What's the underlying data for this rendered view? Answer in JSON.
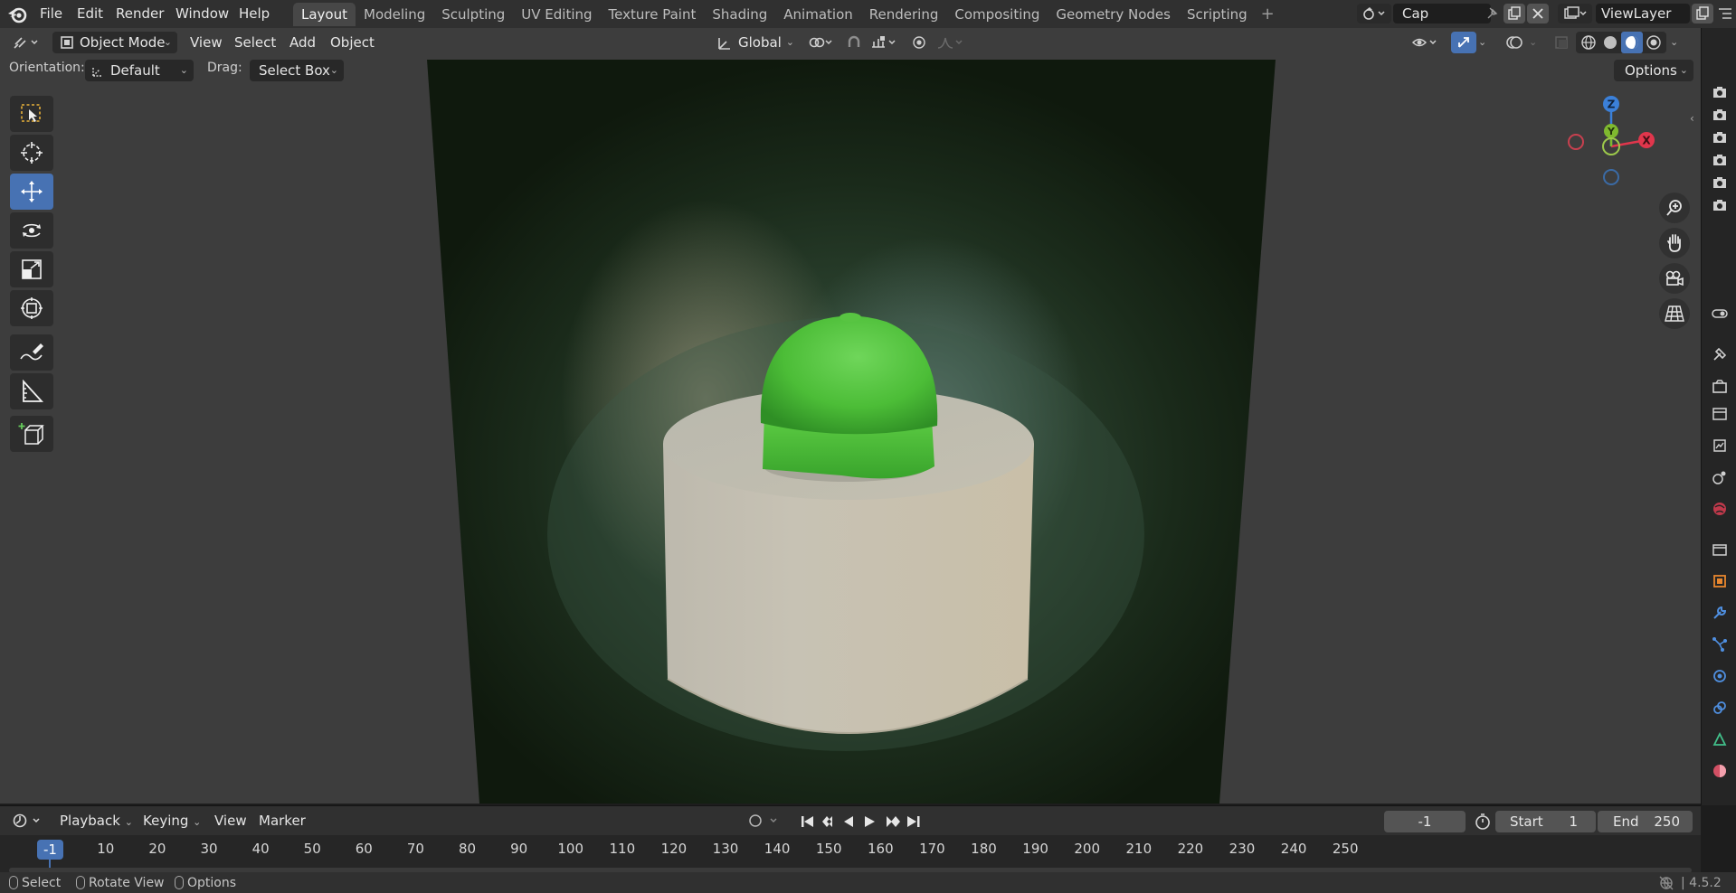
{
  "app": {
    "name": "Blender",
    "version": "4.5.2"
  },
  "menubar": {
    "items": [
      "File",
      "Edit",
      "Render",
      "Window",
      "Help"
    ]
  },
  "workspaces": {
    "active": "Layout",
    "tabs": [
      "Layout",
      "Modeling",
      "Sculpting",
      "UV Editing",
      "Texture Paint",
      "Shading",
      "Animation",
      "Rendering",
      "Compositing",
      "Geometry Nodes",
      "Scripting"
    ]
  },
  "scene": {
    "name": "Cap"
  },
  "view_layer": {
    "name": "ViewLayer"
  },
  "viewport_header": {
    "mode": "Object Mode",
    "menus": [
      "View",
      "Select",
      "Add",
      "Object"
    ],
    "transform_orientation": "Global"
  },
  "tool_settings": {
    "orientation_label": "Orientation:",
    "orientation_value": "Default",
    "drag_label": "Drag:",
    "drag_value": "Select Box",
    "options_label": "Options"
  },
  "toolbar": {
    "tools": [
      {
        "name": "select-box",
        "icon": "select-box-icon",
        "active": false
      },
      {
        "name": "cursor",
        "icon": "cursor-icon",
        "active": false
      },
      {
        "name": "move",
        "icon": "move-icon",
        "active": true
      },
      {
        "name": "rotate",
        "icon": "rotate-icon",
        "active": false
      },
      {
        "name": "scale",
        "icon": "scale-icon",
        "active": false
      },
      {
        "name": "transform",
        "icon": "transform-icon",
        "active": false
      },
      {
        "name": "annotate",
        "icon": "annotate-icon",
        "active": false
      },
      {
        "name": "measure",
        "icon": "measure-icon",
        "active": false
      },
      {
        "name": "add-cube",
        "icon": "add-cube-icon",
        "active": false
      }
    ]
  },
  "gizmo": {
    "x_label": "X",
    "y_label": "Y",
    "z_label": "Z"
  },
  "colors": {
    "accent": "#4772b3",
    "cap_green": "#4fbf3a",
    "pedestal": "#cfc8b8",
    "axis_x": "#e0364c",
    "axis_y": "#7fb92f",
    "axis_z": "#3b80d9"
  },
  "timeline": {
    "menus": [
      "Playback",
      "Keying",
      "View",
      "Marker"
    ],
    "current_frame": "-1",
    "start_label": "Start",
    "start_value": "1",
    "end_label": "End",
    "end_value": "250",
    "ticks": [
      "10",
      "20",
      "30",
      "40",
      "50",
      "60",
      "70",
      "80",
      "90",
      "100",
      "110",
      "120",
      "130",
      "140",
      "150",
      "160",
      "170",
      "180",
      "190",
      "200",
      "210",
      "220",
      "230",
      "240",
      "250"
    ]
  },
  "statusbar": {
    "select": "Select",
    "rotate_view": "Rotate View",
    "options": "Options",
    "version": "4.5.2"
  }
}
